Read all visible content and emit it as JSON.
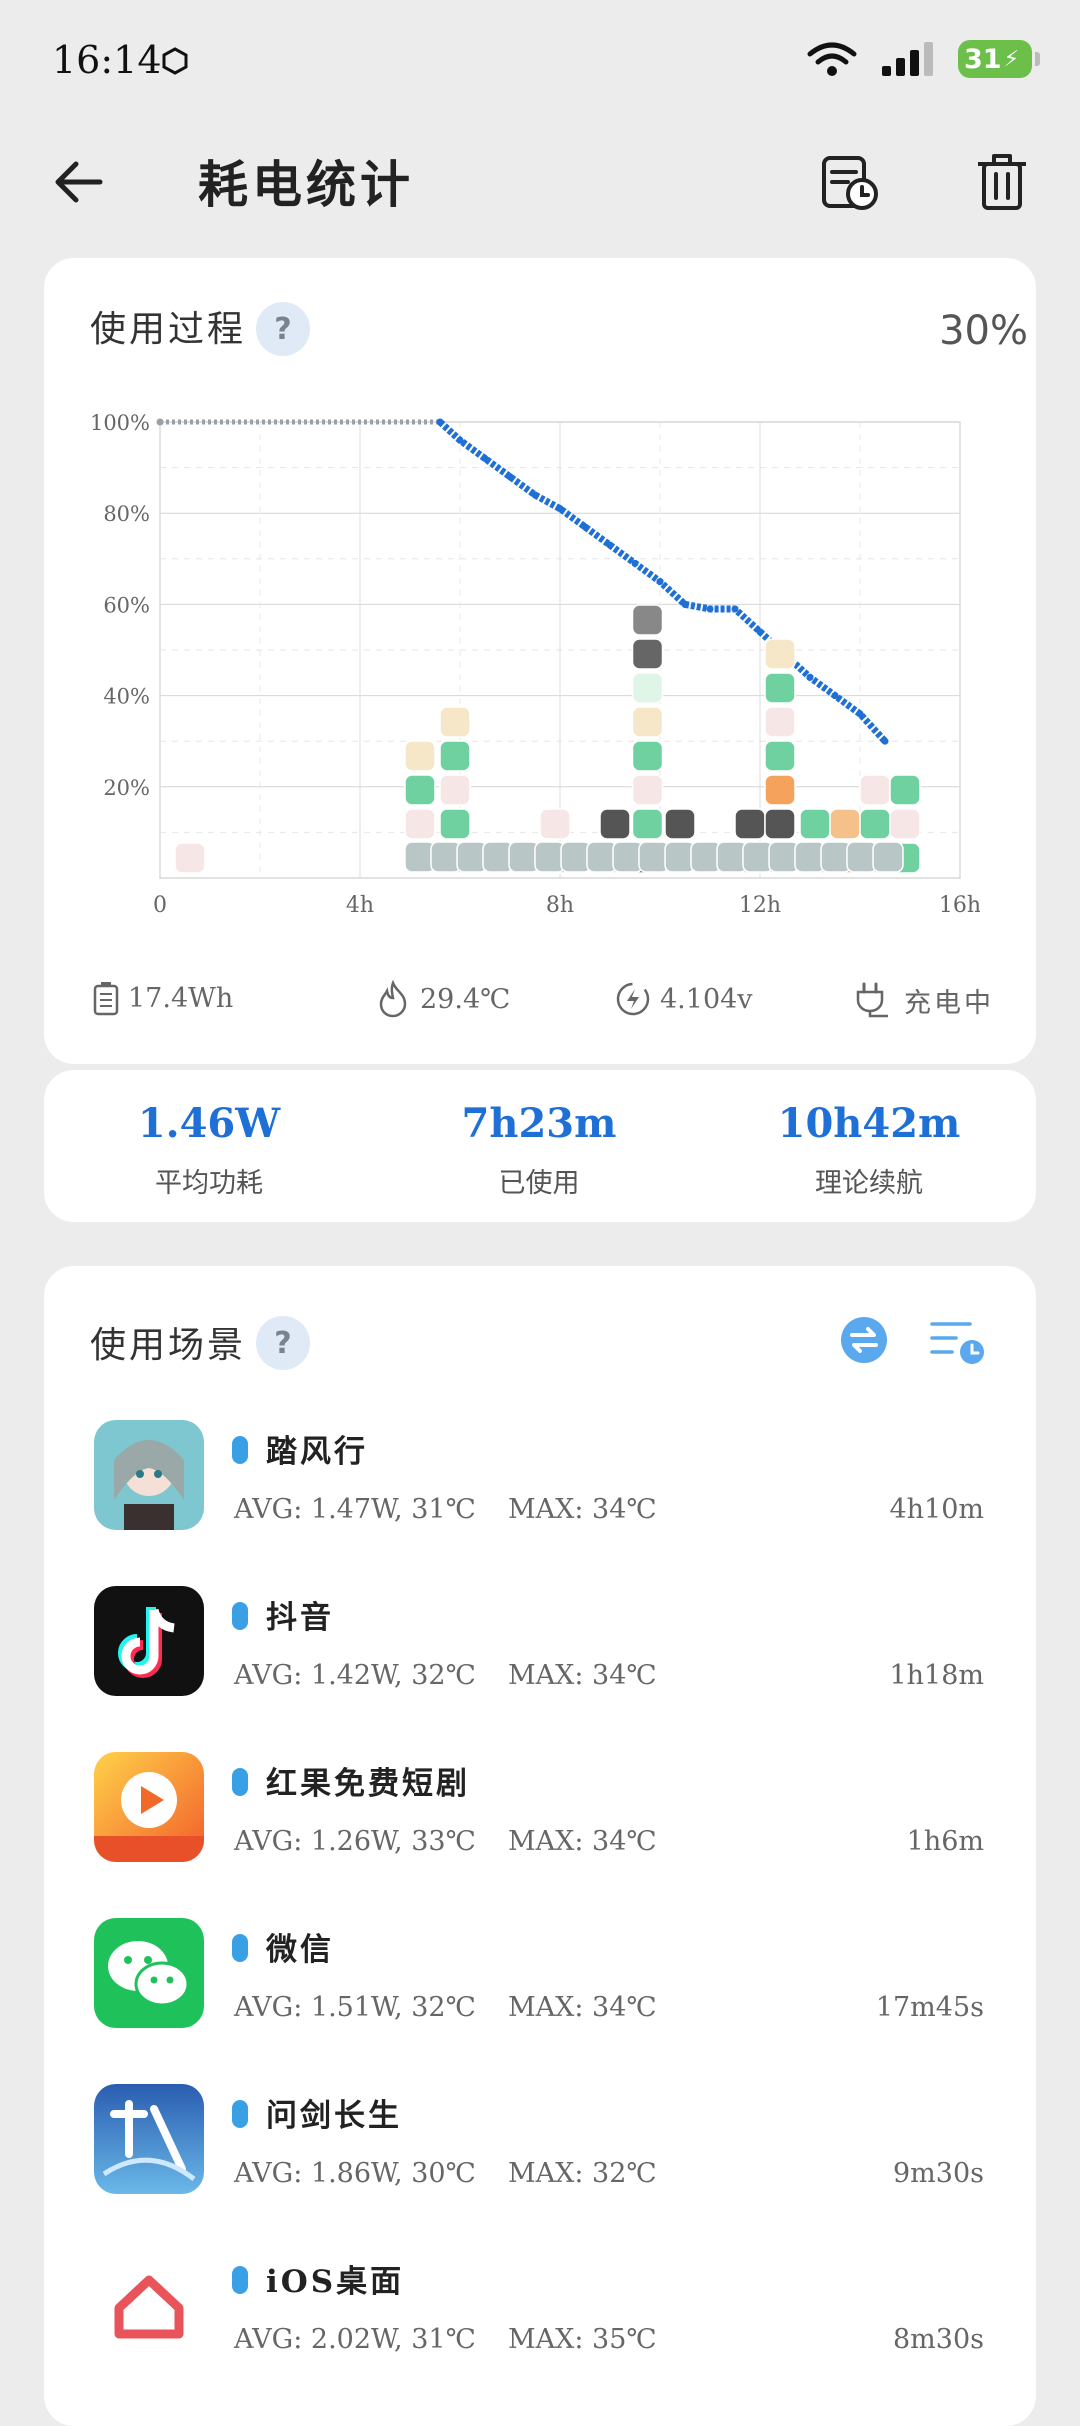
{
  "status_bar": {
    "time": "16:14",
    "battery": "31"
  },
  "header": {
    "title": "耗电统计"
  },
  "usage_card": {
    "title": "使用过程",
    "help": "?",
    "current_percent": "30%",
    "stats": {
      "energy": "17.4Wh",
      "temperature": "29.4℃",
      "voltage": "4.104v",
      "charging": "充电中"
    }
  },
  "chart_data": {
    "type": "line",
    "x_ticks": [
      "0",
      "4h",
      "8h",
      "12h",
      "16h"
    ],
    "y_ticks": [
      "100%",
      "80%",
      "60%",
      "40%",
      "20%"
    ],
    "xlim": [
      0,
      16
    ],
    "ylim": [
      0,
      100
    ],
    "series": [
      {
        "x": [
          0,
          5.6,
          6.0,
          6.5,
          7.0,
          7.5,
          8.0,
          8.5,
          9.0,
          9.5,
          10.0,
          10.5,
          11.0,
          11.5,
          12.0,
          12.5,
          13.0,
          13.5,
          14.0,
          14.5
        ],
        "y": [
          100,
          100,
          96,
          92,
          88,
          84,
          81,
          77,
          73,
          69,
          65,
          60,
          59,
          59,
          54,
          49,
          44,
          40,
          36,
          30
        ]
      }
    ]
  },
  "summary": {
    "avg_power": {
      "value": "1.46W",
      "label": "平均功耗"
    },
    "used": {
      "value": "7h23m",
      "label": "已使用"
    },
    "estimate": {
      "value": "10h42m",
      "label": "理论续航"
    }
  },
  "scenes_card": {
    "title": "使用场景",
    "help": "?"
  },
  "apps": [
    {
      "name": "踏风行",
      "avg": "AVG: 1.47W, 31℃",
      "max": "MAX:  34℃",
      "duration": "4h10m",
      "icon": "game-character-icon",
      "color": "#7ec7d0"
    },
    {
      "name": "抖音",
      "avg": "AVG: 1.42W, 32℃",
      "max": "MAX:  34℃",
      "duration": "1h18m",
      "icon": "douyin-icon",
      "color": "#111111"
    },
    {
      "name": "红果免费短剧",
      "avg": "AVG: 1.26W, 33℃",
      "max": "MAX:  34℃",
      "duration": "1h6m",
      "icon": "play-icon",
      "color": "#f08a3c"
    },
    {
      "name": "微信",
      "avg": "AVG: 1.51W, 32℃",
      "max": "MAX:  34℃",
      "duration": "17m45s",
      "icon": "wechat-icon",
      "color": "#1fc25a"
    },
    {
      "name": "问剑长生",
      "avg": "AVG: 1.86W, 30℃",
      "max": "MAX:  32℃",
      "duration": "9m30s",
      "icon": "game-sword-icon",
      "color": "#2a5db0"
    },
    {
      "name": "iOS桌面",
      "avg": "AVG: 2.02W, 31℃",
      "max": "MAX:  35℃",
      "duration": "8m30s",
      "icon": "home-icon",
      "color": "#e8545a"
    }
  ]
}
